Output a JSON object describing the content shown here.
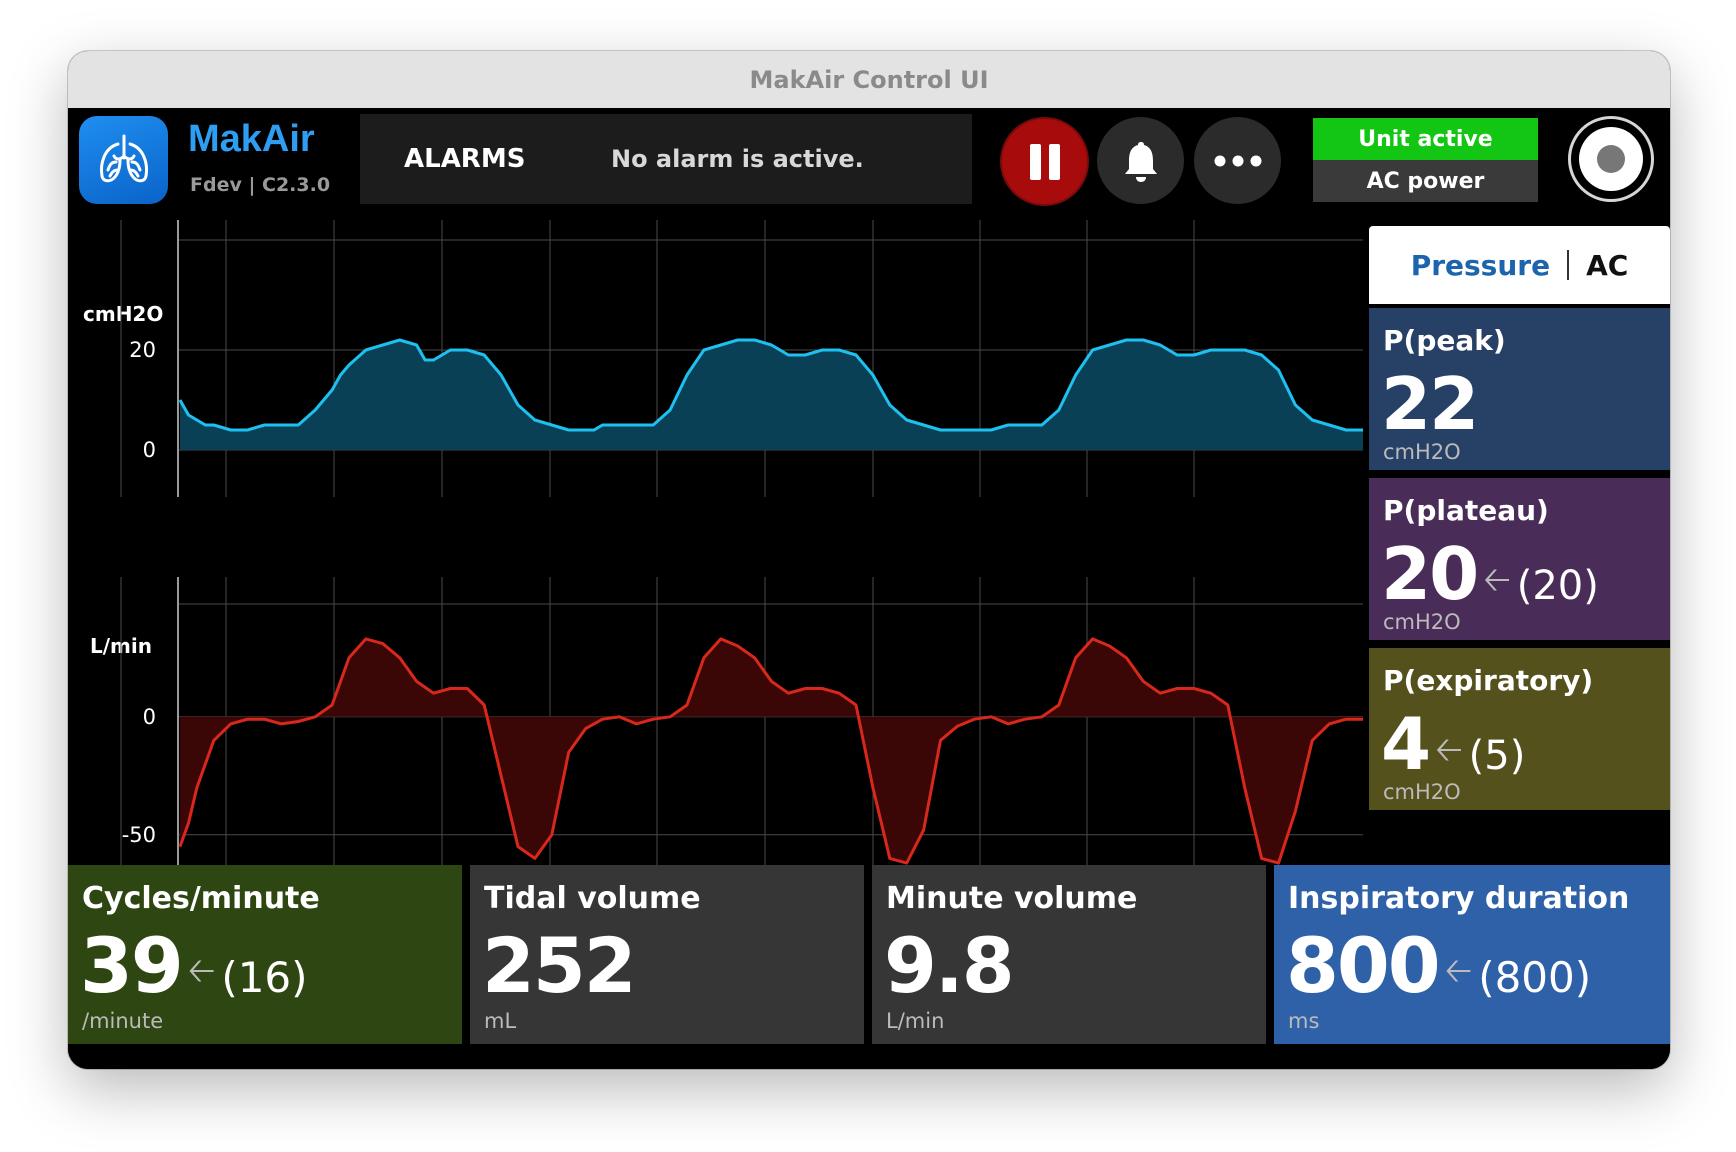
{
  "window": {
    "title": "MakAir Control UI"
  },
  "header": {
    "brand": "MakAir",
    "version": "Fdev | C2.3.0",
    "alarms_label": "ALARMS",
    "alarm_message": "No alarm is active.",
    "unit_status": "Unit active",
    "power_source": "AC power"
  },
  "colors": {
    "pressure_line": "#1ec0ef",
    "pressure_fill": "#0a4056",
    "flow_line": "#d8281c",
    "flow_fill": "#3a0606",
    "unit_active": "#13c613",
    "pause_button": "#a80b0b"
  },
  "icons": [
    "lungs-icon",
    "pause-icon",
    "bell-icon",
    "more-icon",
    "power-icon",
    "arrow-left-icon"
  ],
  "mode": {
    "name": "Pressure",
    "sub": "AC"
  },
  "side_cards": [
    {
      "title": "P(peak)",
      "value": "22",
      "target": "",
      "unit": "cmH2O",
      "color": "#274065"
    },
    {
      "title": "P(plateau)",
      "value": "20",
      "target": "(20)",
      "unit": "cmH2O",
      "color": "#4a2c58"
    },
    {
      "title": "P(expiratory)",
      "value": "4",
      "target": "(5)",
      "unit": "cmH2O",
      "color": "#55511c"
    }
  ],
  "bottom_cards": [
    {
      "title": "Cycles/minute",
      "value": "39",
      "target": "(16)",
      "unit": "/minute",
      "color": "#2e4712"
    },
    {
      "title": "Tidal volume",
      "value": "252",
      "target": "",
      "unit": "mL",
      "color": "#363636"
    },
    {
      "title": "Minute volume",
      "value": "9.8",
      "target": "",
      "unit": "L/min",
      "color": "#363636"
    },
    {
      "title": "Inspiratory duration",
      "value": "800",
      "target": "(800)",
      "unit": "ms",
      "color": "#2f61a8"
    }
  ],
  "chart_data": [
    {
      "type": "area",
      "ylabel": "cmH2O",
      "yticks": [
        0,
        20
      ],
      "ylim": [
        -10,
        40
      ],
      "grid": true,
      "x": [
        0,
        0.5,
        1,
        1.5,
        2,
        3,
        4,
        5,
        6,
        6.5,
        7,
        8,
        9,
        9.5,
        10,
        11,
        12,
        13,
        14,
        14.5,
        15,
        16,
        16.5,
        17,
        18,
        19,
        20,
        21,
        22,
        23,
        24,
        24.5,
        25,
        26,
        27,
        28,
        29,
        30,
        31,
        32,
        33,
        34,
        35,
        36,
        37,
        38,
        38.5,
        39,
        40,
        41,
        42,
        43,
        44,
        45,
        46,
        47,
        48,
        49,
        49.5,
        50,
        51,
        52,
        53,
        54,
        55,
        56,
        57,
        58,
        59,
        60,
        61,
        62,
        63,
        64,
        65,
        66,
        67,
        68,
        69,
        70
      ],
      "series": [
        {
          "values": [
            10,
            7,
            6,
            5,
            5,
            4,
            4,
            5,
            5,
            5,
            5,
            8,
            12,
            15,
            17,
            20,
            21,
            22,
            21,
            18,
            18,
            20,
            20,
            20,
            19,
            15,
            9,
            6,
            5,
            4,
            4,
            4,
            5,
            5,
            5,
            5,
            8,
            15,
            20,
            21,
            22,
            22,
            21,
            19,
            19,
            20,
            20,
            20,
            19,
            15,
            9,
            6,
            5,
            4,
            4,
            4,
            4,
            5,
            5,
            5,
            5,
            8,
            15,
            20,
            21,
            22,
            22,
            21,
            19,
            19,
            20,
            20,
            20,
            19,
            16,
            9,
            6,
            5,
            4,
            4,
            5
          ]
        }
      ]
    },
    {
      "type": "area",
      "ylabel": "L/min",
      "yticks": [
        -50,
        0
      ],
      "ylim": [
        -70,
        55
      ],
      "grid": true,
      "x": [
        0,
        0.5,
        1,
        2,
        3,
        4,
        5,
        6,
        7,
        8,
        9,
        10,
        11,
        12,
        13,
        14,
        15,
        16,
        16.5,
        17,
        18,
        19,
        20,
        21,
        22,
        23,
        24,
        25,
        26,
        27,
        28,
        29,
        30,
        31,
        32,
        33,
        34,
        35,
        36,
        37,
        38,
        39,
        40,
        41,
        42,
        43,
        44,
        45,
        46,
        47,
        48,
        49,
        50,
        51,
        52,
        53,
        54,
        55,
        56,
        57,
        58,
        59,
        60,
        61,
        62,
        63,
        64,
        65,
        66,
        67,
        68,
        69,
        70
      ],
      "series": [
        {
          "values": [
            -55,
            -45,
            -30,
            -10,
            -3,
            -1,
            -1,
            -3,
            -2,
            0,
            5,
            25,
            33,
            31,
            25,
            15,
            10,
            12,
            12,
            12,
            5,
            -25,
            -55,
            -60,
            -50,
            -15,
            -5,
            -1,
            0,
            -3,
            -1,
            0,
            5,
            25,
            33,
            30,
            25,
            15,
            10,
            12,
            12,
            10,
            5,
            -30,
            -60,
            -62,
            -48,
            -10,
            -4,
            -1,
            0,
            -3,
            -1,
            0,
            5,
            25,
            33,
            30,
            25,
            15,
            10,
            12,
            12,
            10,
            5,
            -30,
            -60,
            -62,
            -40,
            -10,
            -3,
            -1,
            -1
          ]
        }
      ]
    }
  ]
}
